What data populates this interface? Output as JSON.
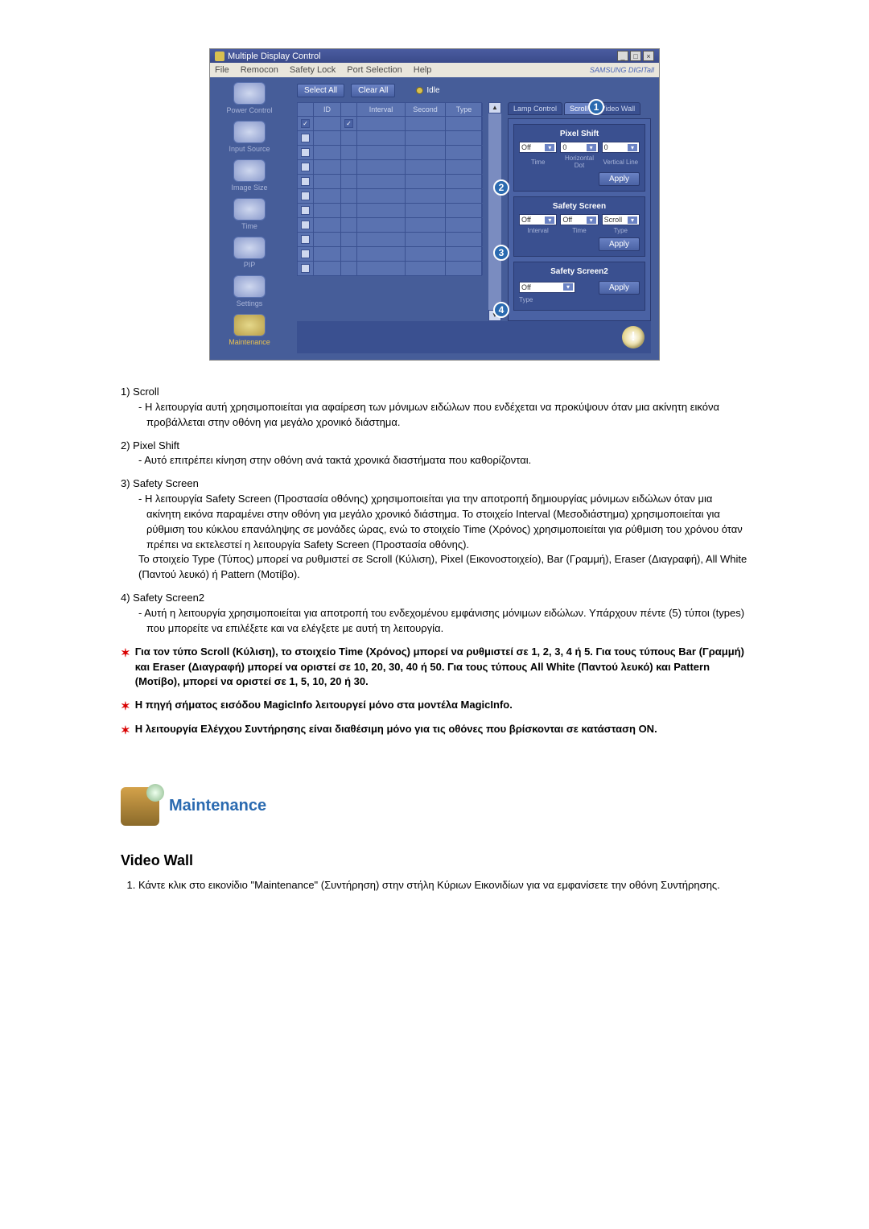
{
  "window": {
    "title": "Multiple Display Control",
    "menu": [
      "File",
      "Remocon",
      "Safety Lock",
      "Port Selection",
      "Help"
    ],
    "brand": "SAMSUNG DIGITall"
  },
  "sidebar": [
    {
      "label": "Power Control"
    },
    {
      "label": "Input Source"
    },
    {
      "label": "Image Size"
    },
    {
      "label": "Time"
    },
    {
      "label": "PIP"
    },
    {
      "label": "Settings"
    },
    {
      "label": "Maintenance"
    }
  ],
  "actions": {
    "select_all": "Select All",
    "clear_all": "Clear All",
    "idle": "Idle"
  },
  "table_headers": [
    "",
    "ID",
    "",
    "Interval",
    "Second",
    "Type"
  ],
  "tabs": [
    "Lamp Control",
    "Scroll",
    "Video Wall"
  ],
  "active_tab": "Scroll",
  "pixel_shift": {
    "title": "Pixel Shift",
    "off": "Off",
    "hd": "0",
    "vl": "0",
    "labels": {
      "time": "Time",
      "hd": "Horizontal Dot",
      "vl": "Vertical Line"
    },
    "apply": "Apply"
  },
  "safety_screen": {
    "title": "Safety Screen",
    "interval": "Off",
    "time": "Off",
    "type": "Scroll",
    "labels": {
      "interval": "Interval",
      "time": "Time",
      "type": "Type"
    },
    "apply": "Apply"
  },
  "safety_screen2": {
    "title": "Safety Screen2",
    "type": "Off",
    "label": "Type",
    "apply": "Apply"
  },
  "badges": {
    "b1": "1",
    "b2": "2",
    "b3": "3",
    "b4": "4"
  },
  "info_icon": "!",
  "bullets": {
    "b1_title": "1)  Scroll",
    "b1_text": "Η λειτουργία αυτή χρησιμοποιείται για αφαίρεση των μόνιμων ειδώλων που ενδέχεται να προκύψουν όταν μια ακίνητη εικόνα προβάλλεται στην οθόνη για μεγάλο χρονικό διάστημα.",
    "b2_title": "2)  Pixel Shift",
    "b2_text": "Αυτό επιτρέπει κίνηση στην οθόνη ανά τακτά χρονικά διαστήματα που καθορίζονται.",
    "b3_title": "3)  Safety Screen",
    "b3_text1": "Η λειτουργία Safety Screen (Προστασία οθόνης) χρησιμοποιείται για την αποτροπή δημιουργίας μόνιμων ειδώλων όταν μια ακίνητη εικόνα παραμένει στην οθόνη για μεγάλο χρονικό διάστημα.  Το στοιχείο Interval (Μεσοδιάστημα) χρησιμοποιείται για ρύθμιση του κύκλου επανάληψης σε μονάδες ώρας, ενώ το στοιχείο Time (Χρόνος) χρησιμοποιείται για ρύθμιση του χρόνου όταν πρέπει να εκτελεστεί η λειτουργία Safety Screen (Προστασία οθόνης).",
    "b3_text2": "Το στοιχείο Type (Τύπος) μπορεί να ρυθμιστεί σε Scroll (Κύλιση), Pixel (Εικονοστοιχείο), Bar (Γραμμή), Eraser (Διαγραφή), All White (Παντού λευκό) ή Pattern (Μοτίβο).",
    "b4_title": "4)  Safety Screen2",
    "b4_text": "Αυτή η λειτουργία χρησιμοποιείται για αποτροπή του ενδεχομένου εμφάνισης μόνιμων ειδώλων. Υπάρχουν πέντε (5) τύποι (types) που μπορείτε να επιλέξετε και να ελέγξετε με αυτή τη λειτουργία."
  },
  "stars": {
    "s1": "Για τον τύπο Scroll (Κύλιση), το στοιχείο Time (Χρόνος) μπορεί να ρυθμιστεί σε 1, 2, 3, 4 ή 5. Για τους τύπους Bar (Γραμμή) και Eraser (Διαγραφή) μπορεί να οριστεί σε 10, 20, 30, 40 ή 50. Για τους τύπους All White (Παντού λευκό) και Pattern (Μοτίβο), μπορεί να οριστεί σε 1, 5, 10, 20 ή 30.",
    "s2": "Η πηγή σήματος εισόδου MagicInfo λειτουργεί μόνο στα μοντέλα MagicInfo.",
    "s3": "Η λειτουργία Ελέγχου Συντήρησης είναι διαθέσιμη μόνο για τις οθόνες που βρίσκονται σε κατάσταση ON."
  },
  "maint_heading": "Maintenance",
  "video_wall": {
    "heading": "Video Wall",
    "step1": "Κάντε κλικ στο εικονίδιο \"Maintenance\" (Συντήρηση) στην στήλη Κύριων Εικονιδίων για να εμφανίσετε την οθόνη Συντήρησης."
  }
}
